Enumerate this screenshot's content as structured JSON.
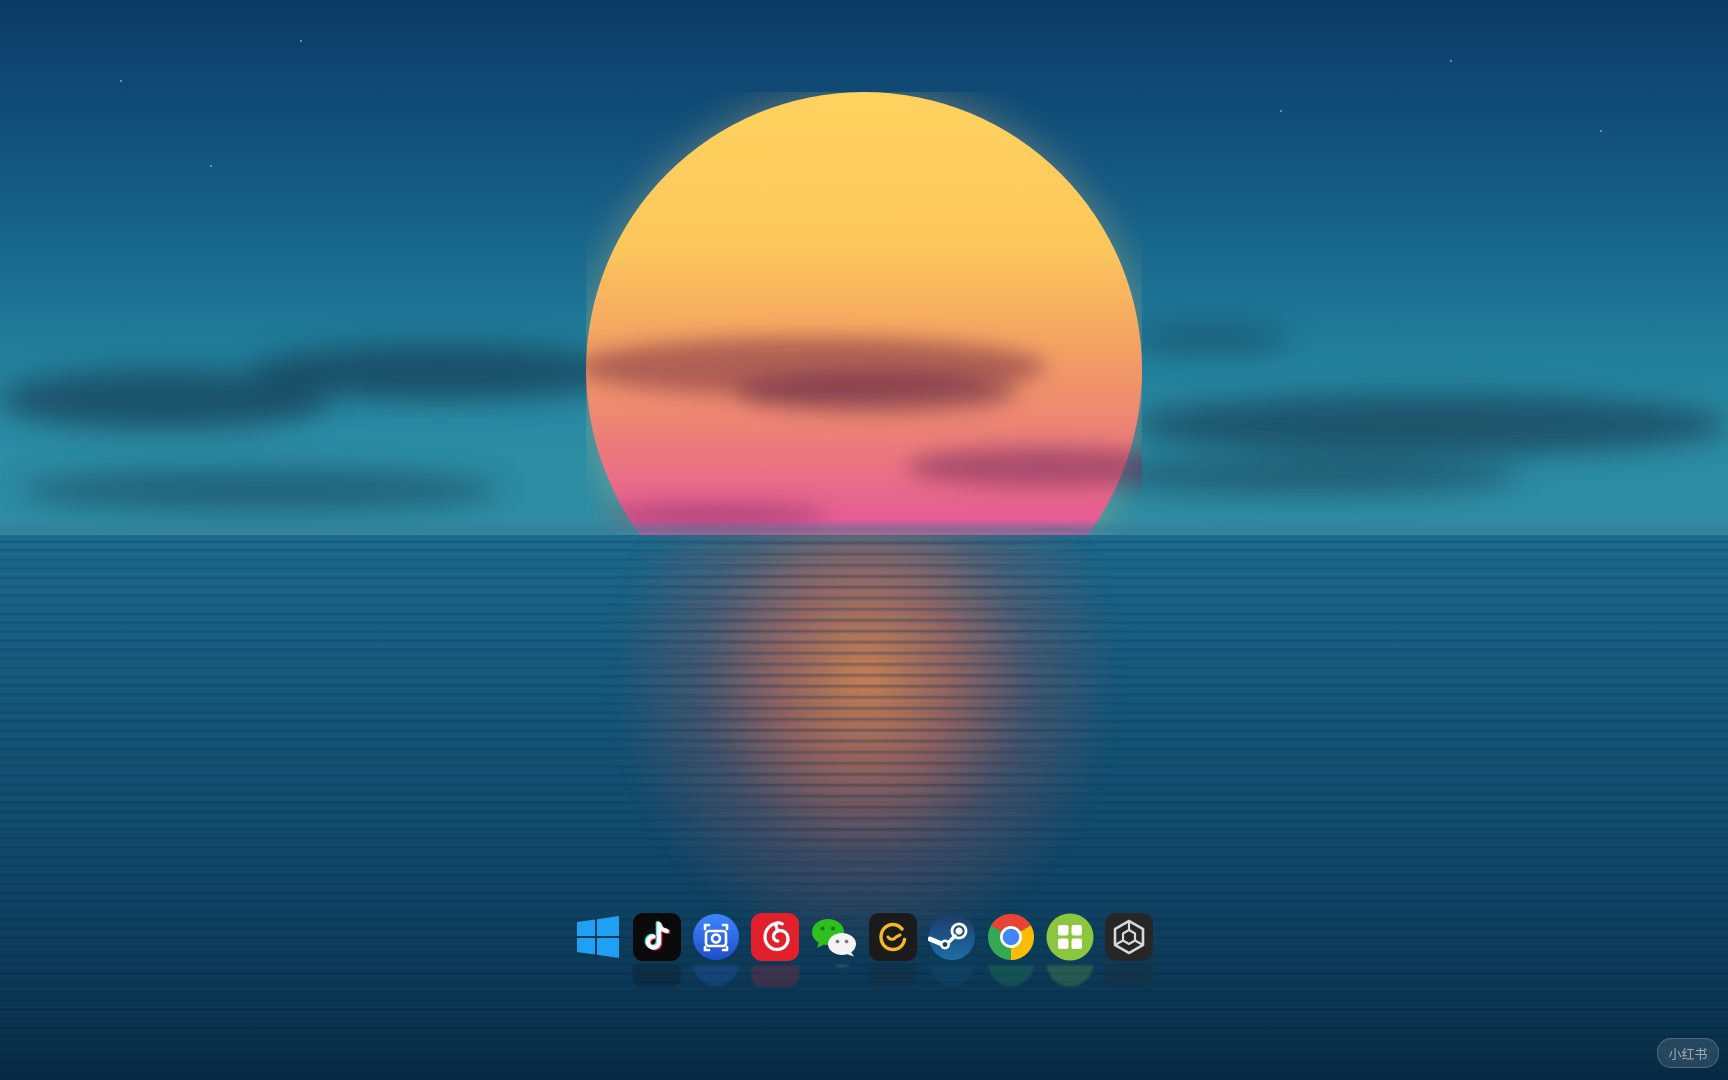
{
  "wallpaper": {
    "scene": "sunset-over-ocean",
    "sun_top_color": "#ffd25e",
    "sun_bottom_color": "#d9489e",
    "sky_color": "#145a83",
    "sea_color": "#114a6c"
  },
  "dock": {
    "items": [
      {
        "name": "windows-start",
        "icon": "windows-logo-icon",
        "color": "#1e9bf0"
      },
      {
        "name": "tiktok",
        "icon": "tiktok-icon",
        "color": "#000000"
      },
      {
        "name": "screenshot-tool",
        "icon": "screenshot-tool-icon",
        "color": "#2f6fe0"
      },
      {
        "name": "netease-cloud-music",
        "icon": "netease-music-icon",
        "color": "#e0242e"
      },
      {
        "name": "wechat",
        "icon": "wechat-icon",
        "color": "#2dc100"
      },
      {
        "name": "app-g",
        "icon": "g-logo-icon",
        "color": "#1a1a1a"
      },
      {
        "name": "steam",
        "icon": "steam-icon",
        "color": "#17354f"
      },
      {
        "name": "chrome",
        "icon": "chrome-icon",
        "color": "#4285f4"
      },
      {
        "name": "app-grid",
        "icon": "four-squares-icon",
        "color": "#8bc34a"
      },
      {
        "name": "unity",
        "icon": "unity-icon",
        "color": "#2b2b2b"
      }
    ]
  },
  "watermark": {
    "text": "小红书"
  }
}
